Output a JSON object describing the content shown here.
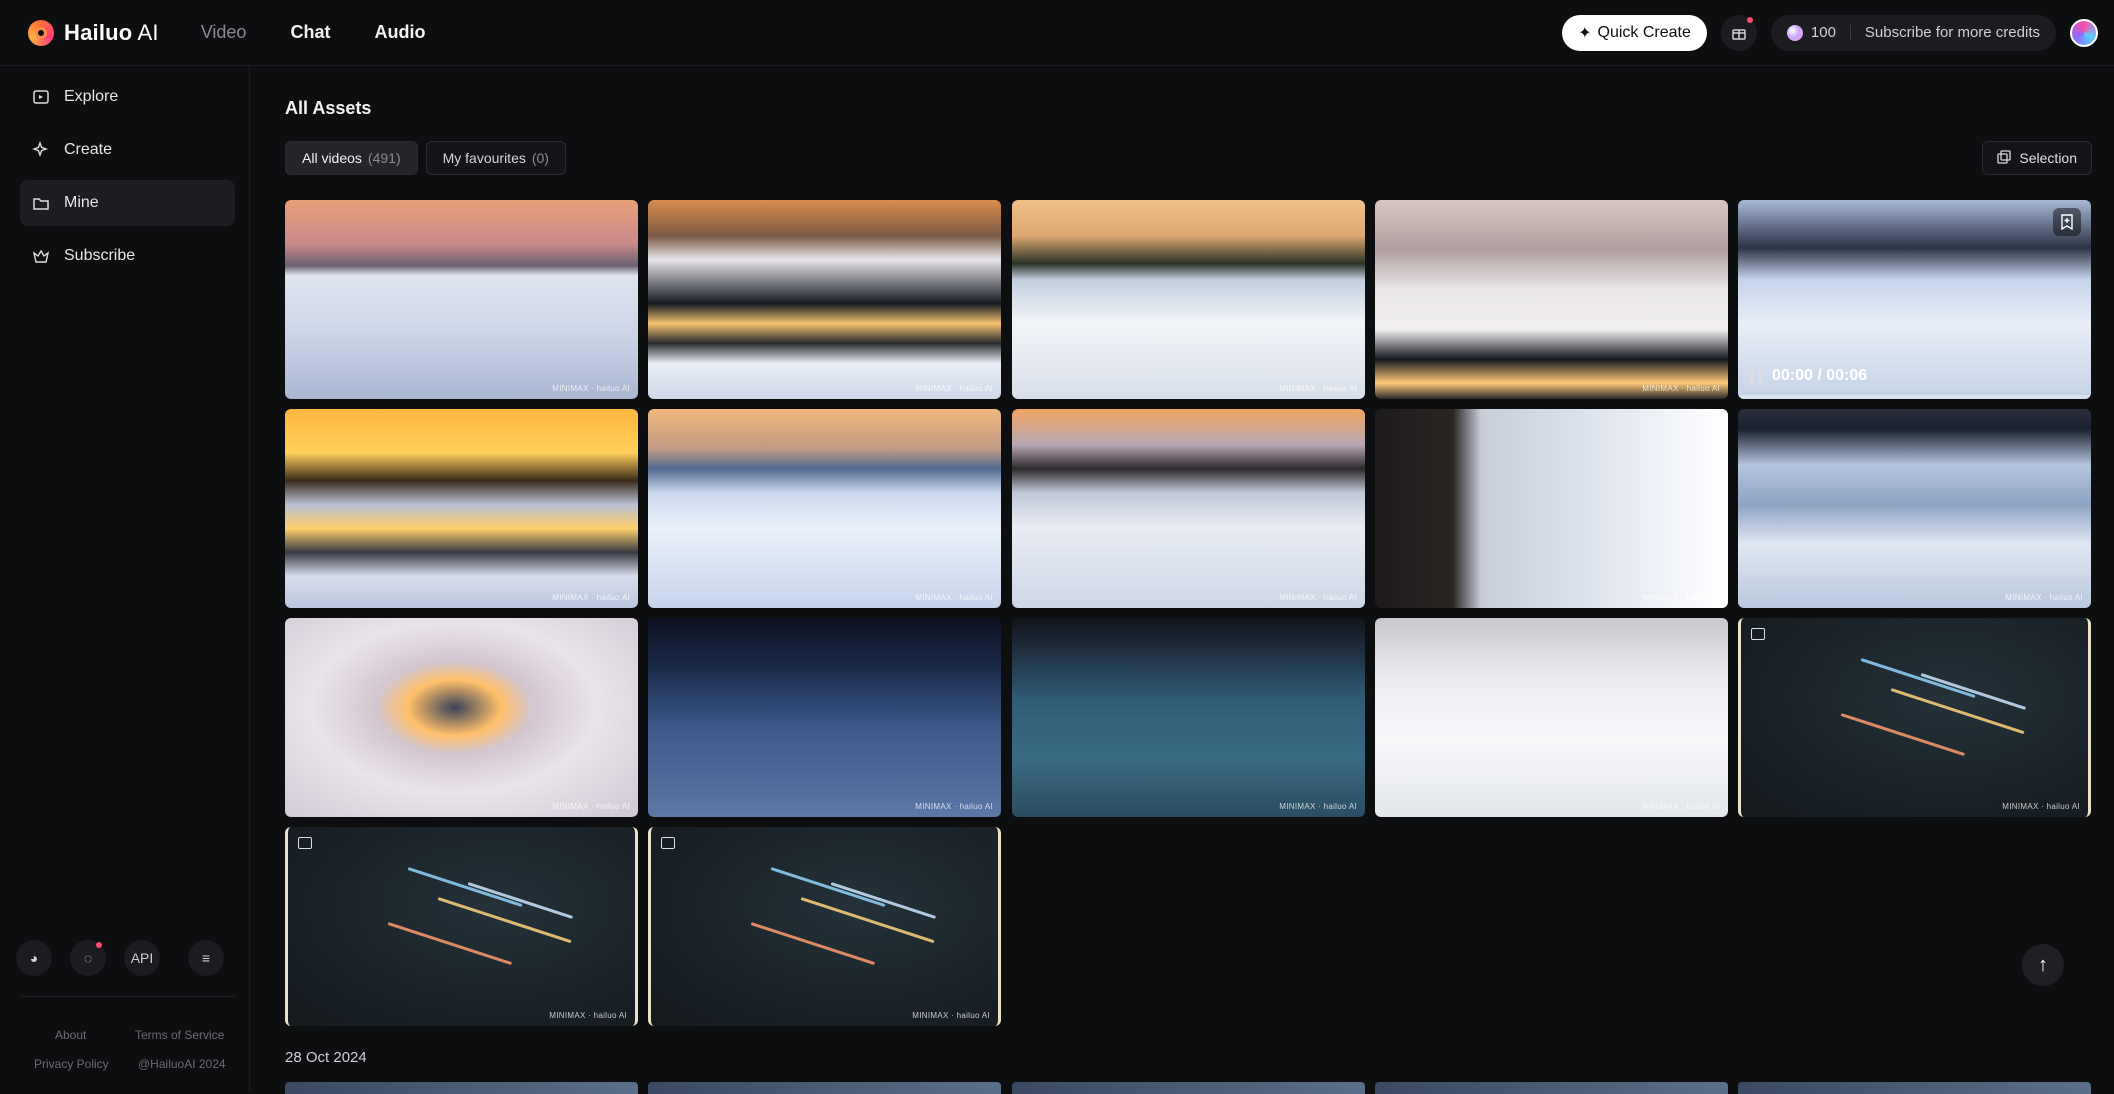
{
  "brand": {
    "name_bold": "Hailuo",
    "name_light": " AI"
  },
  "nav": {
    "video": "Video",
    "chat": "Chat",
    "audio": "Audio"
  },
  "topbar": {
    "quick_create": "Quick Create",
    "credits_count": "100",
    "credits_cta": "Subscribe for more credits"
  },
  "sidebar": {
    "items": [
      {
        "label": "Explore"
      },
      {
        "label": "Create"
      },
      {
        "label": "Mine"
      },
      {
        "label": "Subscribe"
      }
    ],
    "api_label": "API",
    "footer": {
      "about": "About",
      "terms": "Terms of Service",
      "privacy": "Privacy Policy",
      "copyright": "@HailuoAI 2024"
    }
  },
  "main": {
    "title": "All Assets",
    "tabs": [
      {
        "label": "All videos",
        "count": "(491)"
      },
      {
        "label": "My favourites",
        "count": "(0)"
      }
    ],
    "selection_label": "Selection",
    "watermark": "MINIMAX · hailuo AI",
    "hover_timer": "00:00 / 00:06",
    "date_heading": "28 Oct 2024"
  },
  "colors": {
    "accent": "#ffffff",
    "background": "#0d0e10",
    "panel": "#1c1d21"
  }
}
